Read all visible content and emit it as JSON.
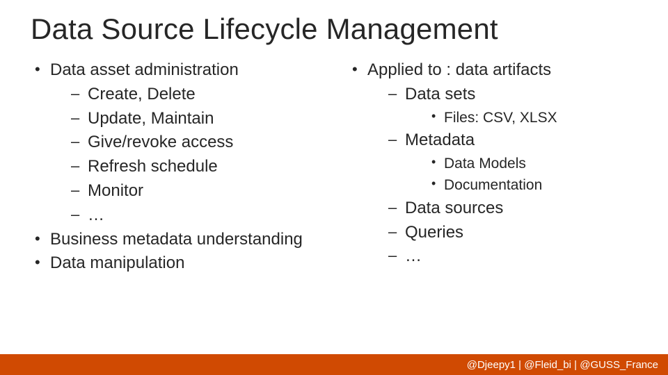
{
  "title": "Data Source Lifecycle Management",
  "left": {
    "i0": "Data asset administration",
    "s0": "Create, Delete",
    "s1": "Update, Maintain",
    "s2": "Give/revoke access",
    "s3": "Refresh schedule",
    "s4": "Monitor",
    "s5": "…",
    "i1": "Business metadata understanding",
    "i2": "Data manipulation"
  },
  "right": {
    "i0": "Applied to : data artifacts",
    "s0": "Data sets",
    "s0a": "Files: CSV, XLSX",
    "s1": "Metadata",
    "s1a": "Data Models",
    "s1b": "Documentation",
    "s2": "Data sources",
    "s3": "Queries",
    "s4": "…"
  },
  "footer": "@Djeepy1 | @Fleid_bi | @GUSS_France"
}
